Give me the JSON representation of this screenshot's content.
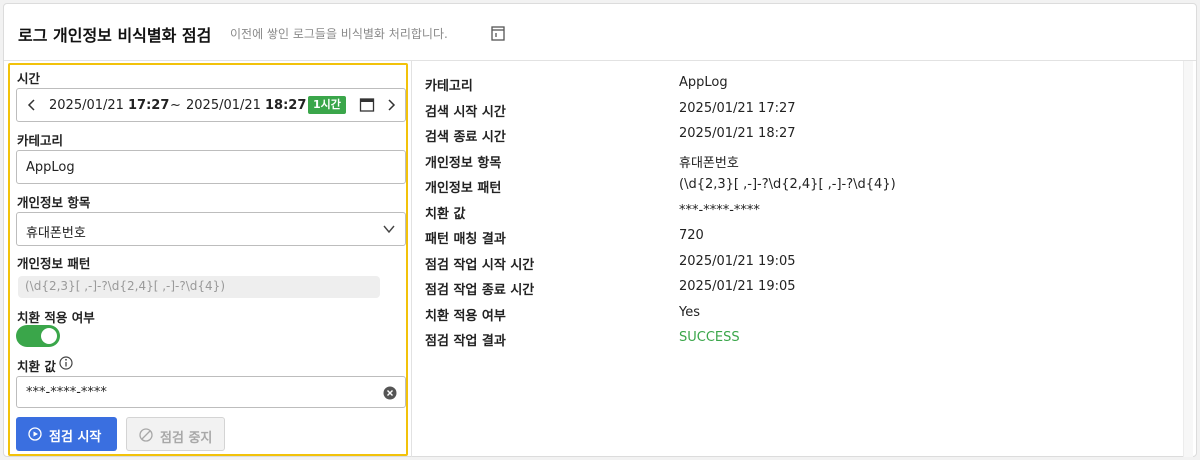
{
  "header": {
    "title": "로그 개인정보 비식별화 점검",
    "subtitle": "이전에 쌓인 로그들을 비식별화 처리합니다."
  },
  "form": {
    "time_label": "시간",
    "time_range": {
      "start_date": "2025/01/21",
      "start_time": "17:27",
      "separator": "~",
      "end_date": "2025/01/21",
      "end_time": "18:27",
      "duration_badge": "1시간"
    },
    "category_label": "카테고리",
    "category_value": "AppLog",
    "pii_item_label": "개인정보 항목",
    "pii_item_value": "휴대폰번호",
    "pii_pattern_label": "개인정보 패턴",
    "pii_pattern_value": "(\\d{2,3}[ ,-]-?\\d{2,4}[ ,-]-?\\d{4})",
    "replace_apply_label": "치환 적용 여부",
    "replace_apply_on": true,
    "replace_value_label": "치환 값",
    "replace_value": "***-****-****",
    "start_button": "점검 시작",
    "stop_button": "점검 중지"
  },
  "details": [
    {
      "key": "카테고리",
      "value": "AppLog"
    },
    {
      "key": "검색 시작 시간",
      "value": "2025/01/21 17:27"
    },
    {
      "key": "검색 종료 시간",
      "value": "2025/01/21 18:27"
    },
    {
      "key": "개인정보 항목",
      "value": "휴대폰번호"
    },
    {
      "key": "개인정보 패턴",
      "value": "(\\d{2,3}[ ,-]-?\\d{2,4}[ ,-]-?\\d{4})"
    },
    {
      "key": "치환 값",
      "value": "***-****-****"
    },
    {
      "key": "패턴 매칭 결과",
      "value": "720"
    },
    {
      "key": "점검 작업 시작 시간",
      "value": "2025/01/21 19:05"
    },
    {
      "key": "점검 작업 종료 시간",
      "value": "2025/01/21 19:05"
    },
    {
      "key": "치환 적용 여부",
      "value": "Yes"
    },
    {
      "key": "점검 작업 결과",
      "value": "SUCCESS",
      "status": "success"
    }
  ],
  "colors": {
    "accent_blue": "#3a6fe0",
    "success_green": "#3aa64a",
    "highlight_border": "#f2c20a"
  },
  "icons": {
    "header": "document-icon",
    "time_prev": "chevron-left-icon",
    "time_next": "chevron-right-icon",
    "calendar": "calendar-icon",
    "select": "chevron-down-icon",
    "info": "info-icon",
    "clear": "clear-icon",
    "start": "play-circle-icon",
    "stop": "stop-circle-icon"
  }
}
